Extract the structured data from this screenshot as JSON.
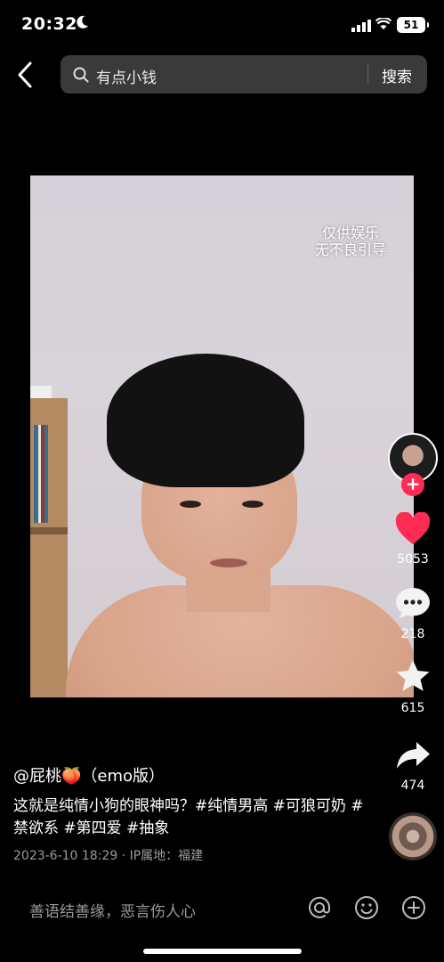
{
  "status_bar": {
    "time": "20:32",
    "battery": "51"
  },
  "search": {
    "query": "有点小钱",
    "button": "搜索"
  },
  "video": {
    "overlay_lines": [
      "仅供娱乐",
      "无不良引导"
    ]
  },
  "actions": {
    "likes": "5053",
    "comments": "218",
    "favorites": "615",
    "shares": "474"
  },
  "post": {
    "author": "@屁桃🍑（emo版）",
    "description": "这就是纯情小狗的眼神吗？#纯情男高 #可狼可奶 #禁欲系 #第四爱 #抽象",
    "meta": "2023-6-10 18:29 · IP属地：福建"
  },
  "comment_bar": {
    "placeholder": "善语结善缘，恶言伤人心"
  },
  "colors": {
    "like": "#fe2c55",
    "background": "#000000",
    "search_bg": "#3a3a3a"
  }
}
